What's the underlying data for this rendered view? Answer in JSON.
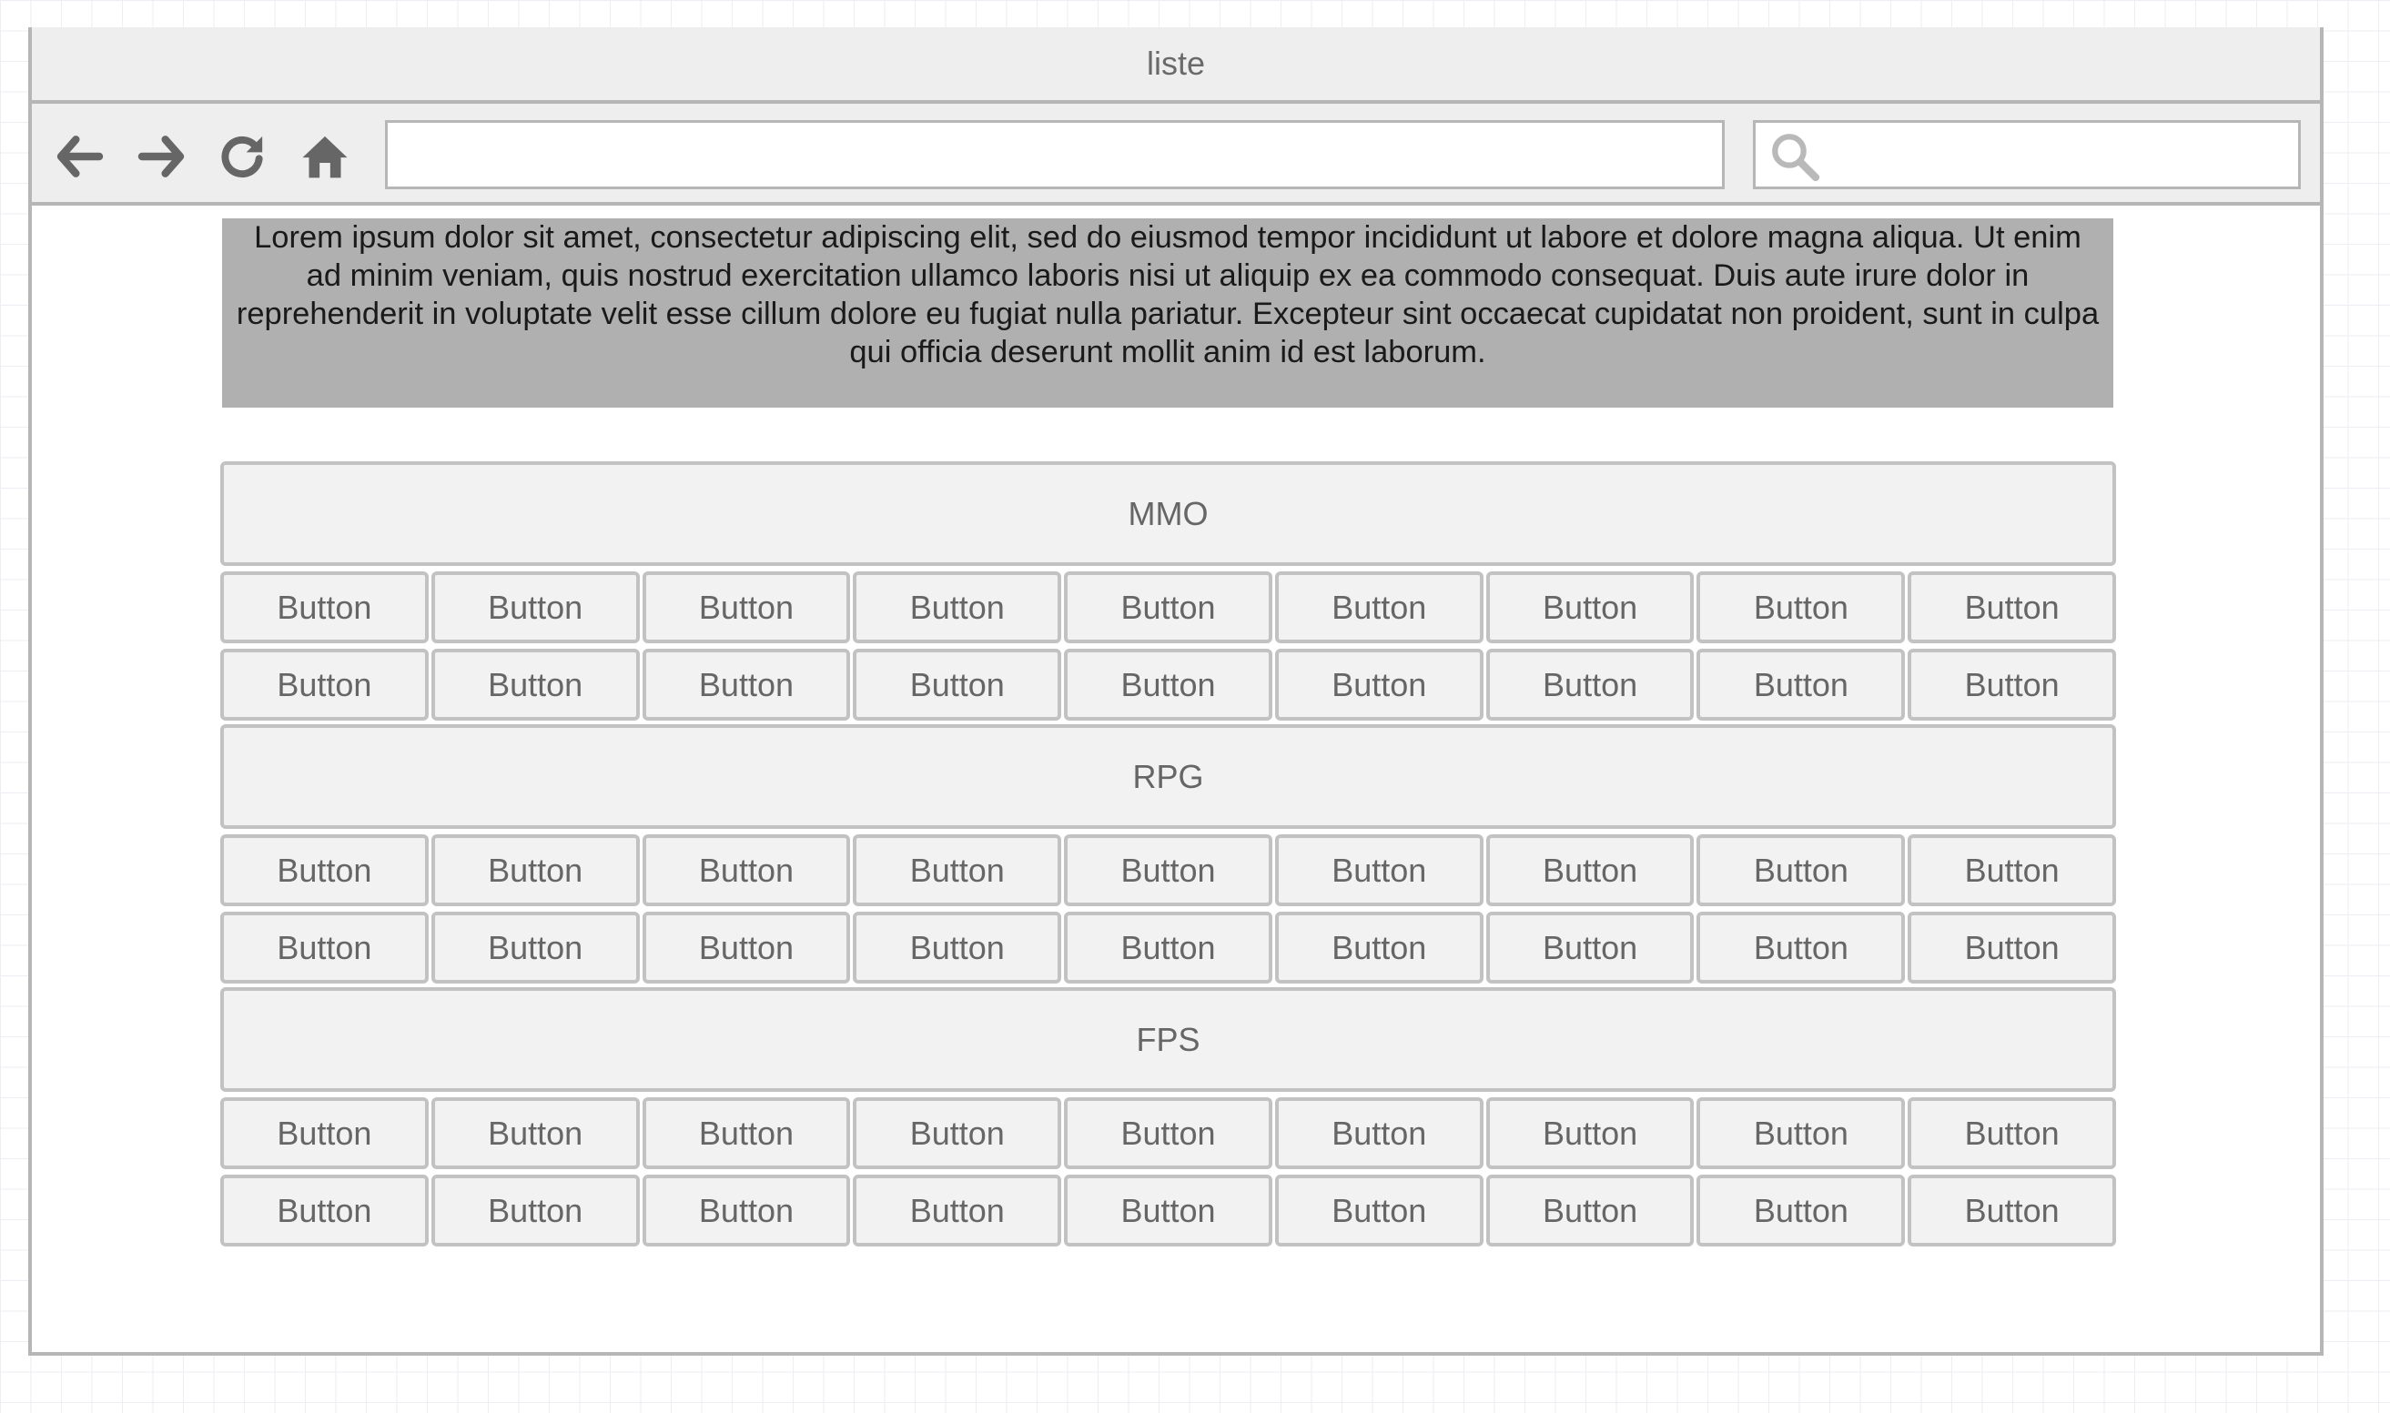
{
  "window": {
    "title": "liste"
  },
  "toolbar": {
    "icons": [
      "back-arrow-icon",
      "forward-arrow-icon",
      "reload-icon",
      "home-icon"
    ],
    "address_value": "",
    "search_value": "",
    "search_icon": "search-icon"
  },
  "intro_text": "Lorem ipsum dolor sit amet, consectetur adipiscing elit, sed do eiusmod tempor incididunt ut labore et dolore magna aliqua. Ut enim ad minim veniam, quis nostrud exercitation ullamco laboris nisi ut aliquip ex ea commodo consequat. Duis aute irure dolor in reprehenderit in voluptate velit esse cillum dolore eu fugiat nulla pariatur. Excepteur sint occaecat cupidatat non proident, sunt in culpa qui officia deserunt mollit anim id est laborum.",
  "categories": [
    {
      "title": "MMO",
      "rows": [
        [
          "Button",
          "Button",
          "Button",
          "Button",
          "Button",
          "Button",
          "Button",
          "Button",
          "Button"
        ],
        [
          "Button",
          "Button",
          "Button",
          "Button",
          "Button",
          "Button",
          "Button",
          "Button",
          "Button"
        ]
      ]
    },
    {
      "title": "RPG",
      "rows": [
        [
          "Button",
          "Button",
          "Button",
          "Button",
          "Button",
          "Button",
          "Button",
          "Button",
          "Button"
        ],
        [
          "Button",
          "Button",
          "Button",
          "Button",
          "Button",
          "Button",
          "Button",
          "Button",
          "Button"
        ]
      ]
    },
    {
      "title": "FPS",
      "rows": [
        [
          "Button",
          "Button",
          "Button",
          "Button",
          "Button",
          "Button",
          "Button",
          "Button",
          "Button"
        ],
        [
          "Button",
          "Button",
          "Button",
          "Button",
          "Button",
          "Button",
          "Button",
          "Button",
          "Button"
        ]
      ]
    }
  ],
  "colors": {
    "frame_border": "#b6b6b6",
    "bar_background": "#eeeeee",
    "intro_background": "#b0b0b0",
    "button_background": "#f2f2f2",
    "button_border": "#c2c2c2",
    "button_text": "#666666",
    "icon_color": "#666666"
  }
}
